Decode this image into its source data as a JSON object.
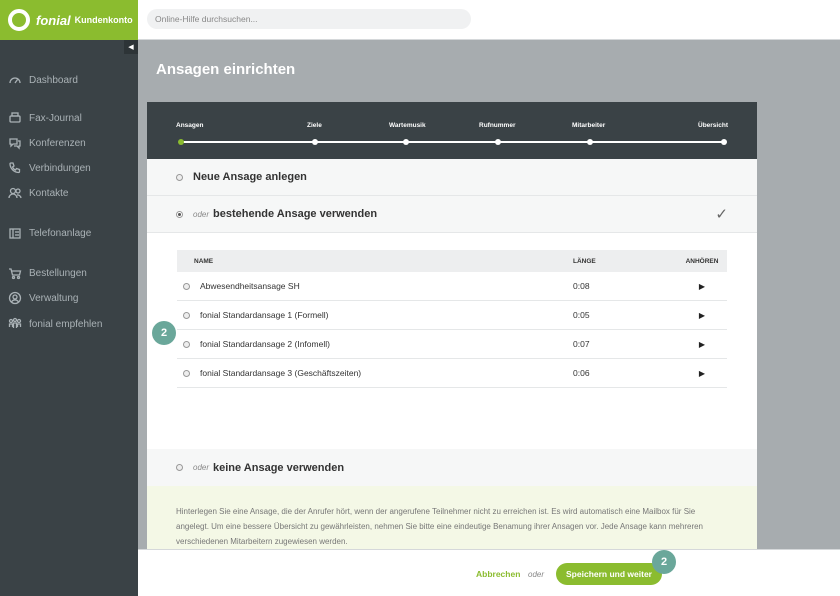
{
  "brand": {
    "name": "fonial",
    "sub": "Kundenkonto"
  },
  "search": {
    "placeholder": "Online-Hilfe durchsuchen..."
  },
  "sidebar": {
    "collapse_glyph": "◀",
    "items": [
      {
        "label": "Dashboard",
        "icon": "dashboard-icon"
      },
      {
        "label": "Fax-Journal",
        "icon": "fax-icon"
      },
      {
        "label": "Konferenzen",
        "icon": "conference-icon"
      },
      {
        "label": "Verbindungen",
        "icon": "phone-icon"
      },
      {
        "label": "Kontakte",
        "icon": "contacts-icon"
      },
      {
        "label": "Telefonanlage",
        "icon": "pbx-icon"
      },
      {
        "label": "Bestellungen",
        "icon": "cart-icon"
      },
      {
        "label": "Verwaltung",
        "icon": "user-icon"
      },
      {
        "label": "fonial empfehlen",
        "icon": "recommend-icon"
      }
    ]
  },
  "page": {
    "title": "Ansagen einrichten"
  },
  "steps": [
    {
      "label": "Ansagen",
      "active": true
    },
    {
      "label": "Ziele",
      "active": false
    },
    {
      "label": "Wartemusik",
      "active": false
    },
    {
      "label": "Rufnummer",
      "active": false
    },
    {
      "label": "Mitarbeiter",
      "active": false
    },
    {
      "label": "Übersicht",
      "active": false
    }
  ],
  "options": {
    "new": {
      "label": "Neue Ansage anlegen"
    },
    "existing": {
      "oder": "oder",
      "label": "bestehende Ansage verwenden",
      "check": "✓"
    },
    "none": {
      "oder": "oder",
      "label": "keine Ansage verwenden"
    }
  },
  "table": {
    "headers": {
      "name": "NAME",
      "length": "LÄNGE",
      "listen": "ANHÖREN"
    },
    "rows": [
      {
        "name": "Abwesendheitsansage SH",
        "length": "0:08",
        "play": "▶"
      },
      {
        "name": "fonial Standardansage 1 (Formell)",
        "length": "0:05",
        "play": "▶"
      },
      {
        "name": "fonial Standardansage 2 (Infomell)",
        "length": "0:07",
        "play": "▶"
      },
      {
        "name": "fonial Standardansage 3 (Geschäftszeiten)",
        "length": "0:06",
        "play": "▶"
      }
    ]
  },
  "info": {
    "text": "Hinterlegen Sie eine Ansage, die der Anrufer hört, wenn der angerufene Teilnehmer nicht zu erreichen ist. Es wird automatisch eine Mailbox für Sie angelegt. Um eine bessere Übersicht zu gewährleisten, nehmen Sie bitte eine eindeutige Benamung ihrer Ansagen vor. Jede Ansage kann mehreren verschiedenen Mitarbeitern zugewiesen werden."
  },
  "badges": {
    "left": "2",
    "footer": "2"
  },
  "footer": {
    "cancel": "Abbrechen",
    "oder": "oder",
    "save": "Speichern und weiter"
  },
  "colors": {
    "accent": "#8bbc2f",
    "sidebar": "#3a4246",
    "badge": "#6aa79a"
  }
}
